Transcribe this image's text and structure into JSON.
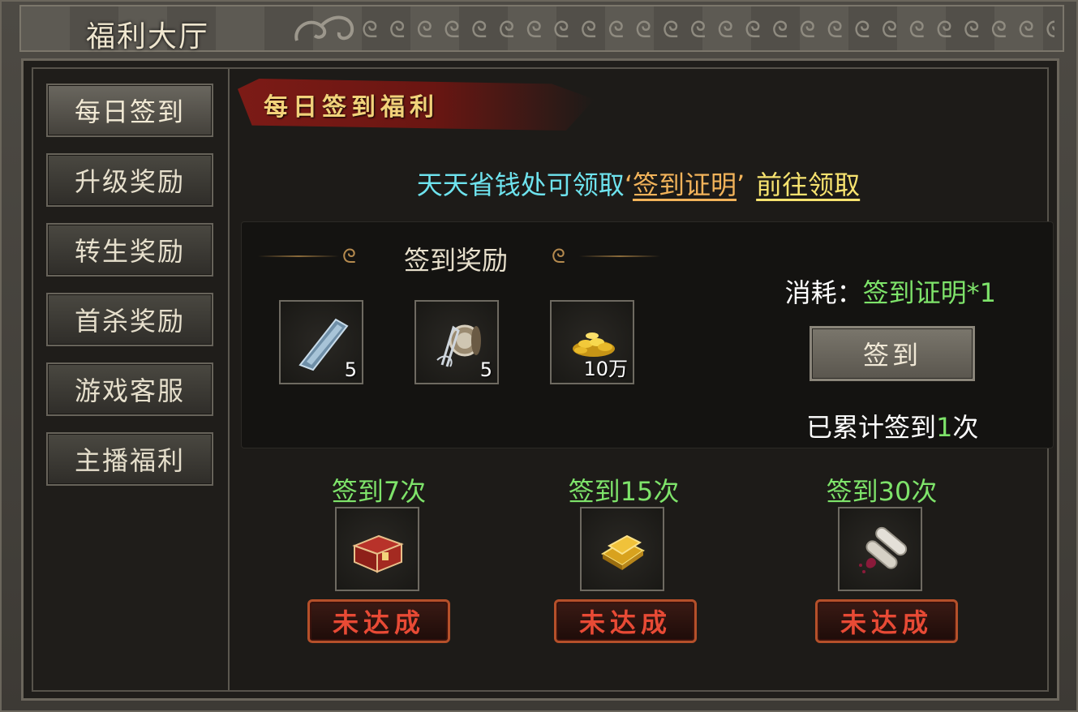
{
  "window": {
    "title": "福利大厅"
  },
  "sidebar": {
    "items": [
      {
        "label": "每日签到",
        "active": true
      },
      {
        "label": "升级奖励",
        "active": false
      },
      {
        "label": "转生奖励",
        "active": false
      },
      {
        "label": "首杀奖励",
        "active": false
      },
      {
        "label": "游戏客服",
        "active": false
      },
      {
        "label": "主播福利",
        "active": false
      }
    ]
  },
  "content": {
    "banner_title": "每日签到福利",
    "notice": {
      "prefix": "天天省钱处可领取",
      "open_quote": "‘",
      "item_link": "签到证明",
      "close_quote": "’",
      "goto_link": "前往领取"
    },
    "rewards": {
      "header": "签到奖励",
      "items": [
        {
          "icon": "blade-icon",
          "count": "5"
        },
        {
          "icon": "thread-spool-icon",
          "count": "5"
        },
        {
          "icon": "gold-coins-icon",
          "count": "10万"
        }
      ],
      "cost_label": "消耗：",
      "cost_value": "签到证明*1",
      "sign_button": "签到",
      "total_prefix": "已累计签到",
      "total_count": "1",
      "total_suffix": "次"
    },
    "milestones": [
      {
        "label": "签到7次",
        "icon": "red-chest-icon",
        "status": "未达成"
      },
      {
        "label": "签到15次",
        "icon": "gold-bars-icon",
        "status": "未达成"
      },
      {
        "label": "签到30次",
        "icon": "scroll-icon",
        "status": "未达成"
      }
    ]
  },
  "colors": {
    "accent_green": "#7ee36a",
    "notice_cyan": "#6ee3ee",
    "link_orange": "#f2b35a",
    "link_yellow": "#f7e36f",
    "status_red": "#e84a35"
  }
}
